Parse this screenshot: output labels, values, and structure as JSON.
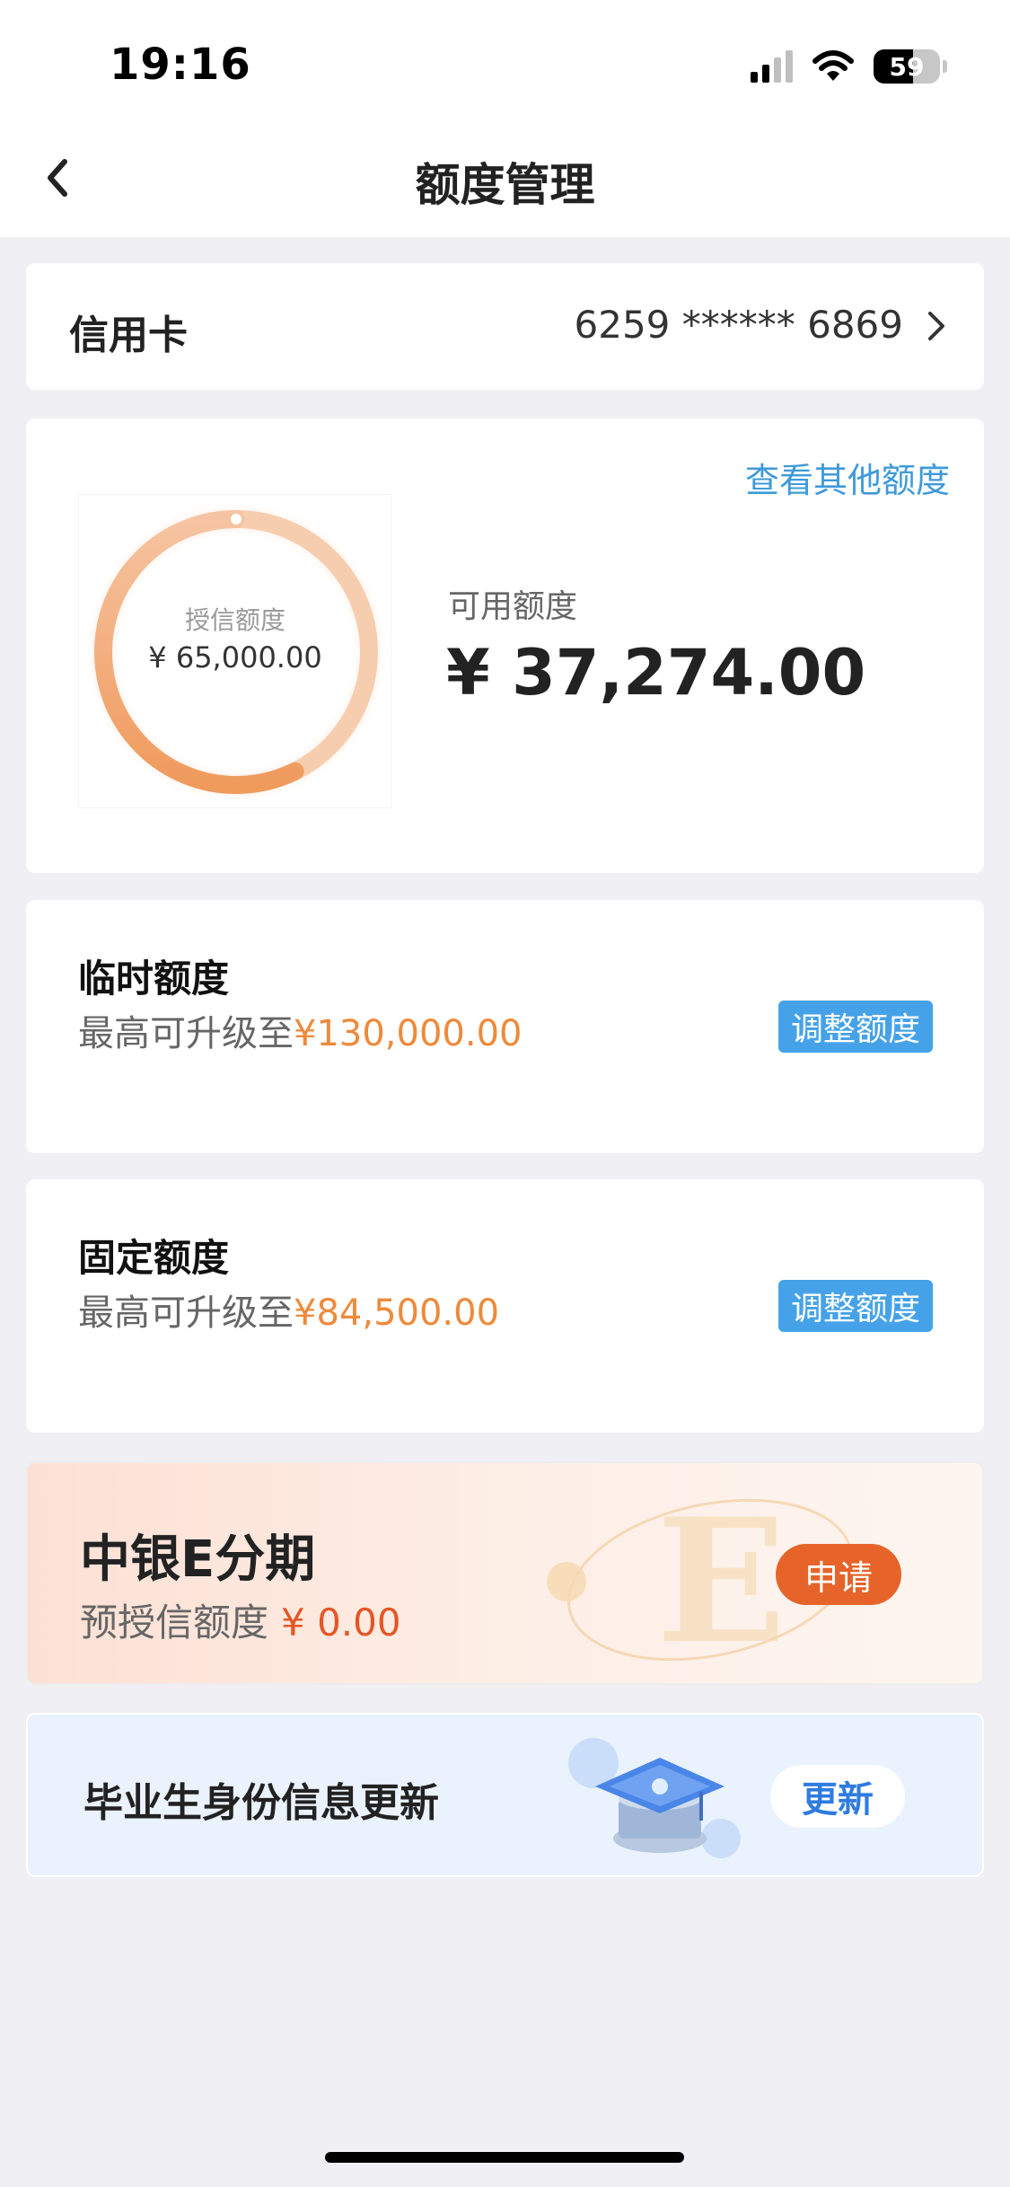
{
  "status_bar": {
    "time": "19:16",
    "battery": "59"
  },
  "nav": {
    "title": "额度管理"
  },
  "card_row": {
    "label": "信用卡",
    "number": "6259 ****** 6869"
  },
  "quota": {
    "other_link": "查看其他额度",
    "ring_label": "授信额度",
    "ring_value": "¥ 65,000.00",
    "available_label": "可用额度",
    "available_value": "¥ 37,274.00",
    "available_fraction": 0.573
  },
  "temp_quota": {
    "title": "临时额度",
    "sub_prefix": "最高可升级至",
    "amount": "¥130,000.00",
    "button": "调整额度"
  },
  "fixed_quota": {
    "title": "固定额度",
    "sub_prefix": "最高可升级至",
    "amount": "¥84,500.00",
    "button": "调整额度"
  },
  "e_installment": {
    "title": "中银E分期",
    "sub_label": "预授信额度",
    "amount": "¥ 0.00",
    "button": "申请",
    "deco_letter": "E"
  },
  "graduate": {
    "title": "毕业生身份信息更新",
    "button": "更新"
  },
  "colors": {
    "accent_blue": "#45a2e8",
    "link_blue": "#3f9ad9",
    "orange": "#ee8a3c",
    "apply_orange": "#e6642a"
  }
}
